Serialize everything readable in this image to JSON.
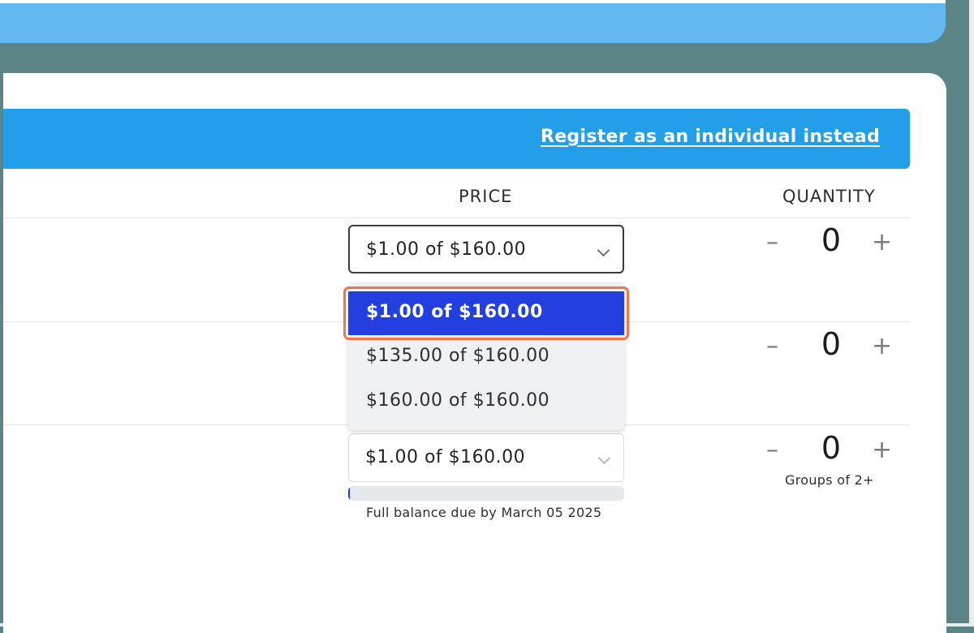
{
  "header": {
    "register_link": "Register as an individual instead"
  },
  "columns": {
    "price": "PRICE",
    "quantity": "QUANTITY"
  },
  "rows": [
    {
      "price_select": "$1.00 of $160.00",
      "quantity": "0"
    },
    {
      "quantity": "0"
    },
    {
      "price_select": "$1.00 of $160.00",
      "quantity": "0",
      "quantity_note": "Groups of 2+",
      "balance_note": "Full balance due by March 05 2025",
      "payment_progress": 0.00625
    }
  ],
  "dropdown": {
    "options": [
      "$1.00 of $160.00",
      "$135.00 of $160.00",
      "$160.00 of $160.00"
    ],
    "selected_index": 0
  },
  "stepper": {
    "minus": "–",
    "plus": "+"
  },
  "colors": {
    "accent": "#233fe0",
    "header": "#229fe8",
    "highlight": "#f2744a"
  }
}
